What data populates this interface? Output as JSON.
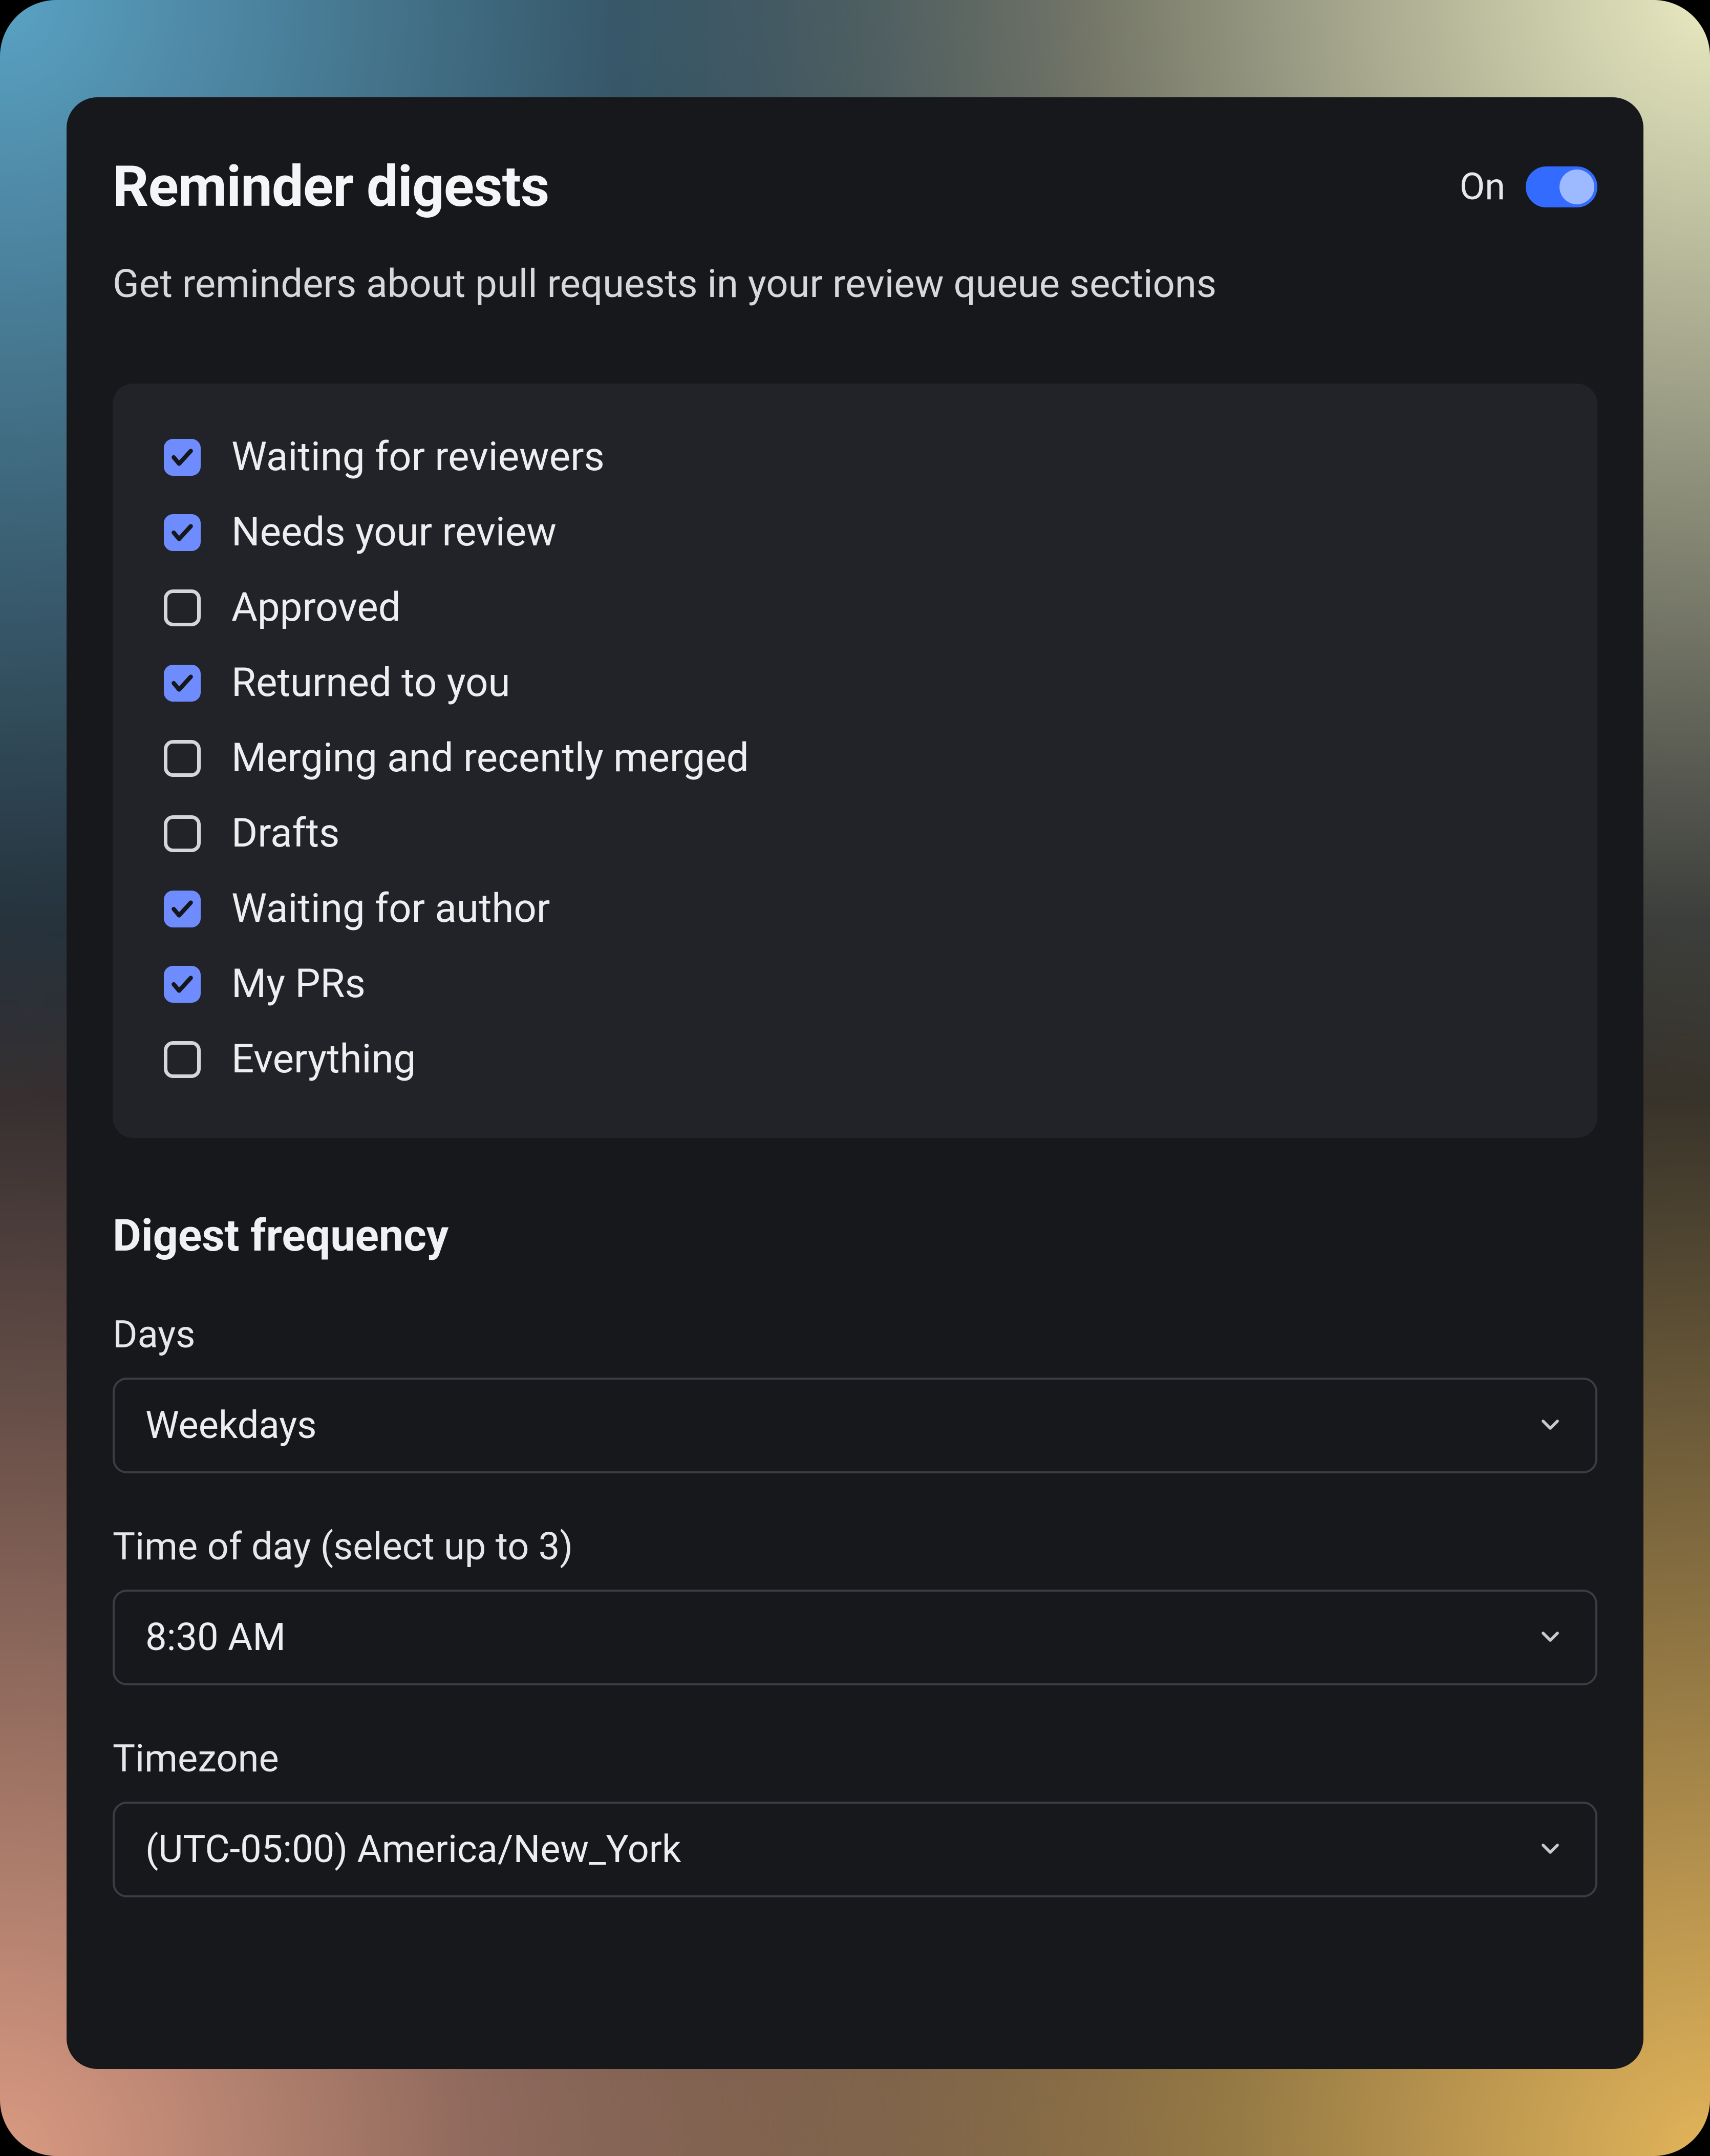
{
  "header": {
    "title": "Reminder digests",
    "toggle_label": "On",
    "toggle_on": true
  },
  "subtitle": "Get reminders about pull requests in your review queue sections",
  "sections": [
    {
      "label": "Waiting for reviewers",
      "checked": true
    },
    {
      "label": "Needs your review",
      "checked": true
    },
    {
      "label": "Approved",
      "checked": false
    },
    {
      "label": "Returned to you",
      "checked": true
    },
    {
      "label": "Merging and recently merged",
      "checked": false
    },
    {
      "label": "Drafts",
      "checked": false
    },
    {
      "label": "Waiting for author",
      "checked": true
    },
    {
      "label": "My PRs",
      "checked": true
    },
    {
      "label": "Everything",
      "checked": false
    }
  ],
  "frequency": {
    "heading": "Digest frequency",
    "days_label": "Days",
    "days_value": "Weekdays",
    "time_label": "Time of day (select up to 3)",
    "time_value": "8:30 AM",
    "tz_label": "Timezone",
    "tz_value": "(UTC-05:00) America/New_York"
  }
}
